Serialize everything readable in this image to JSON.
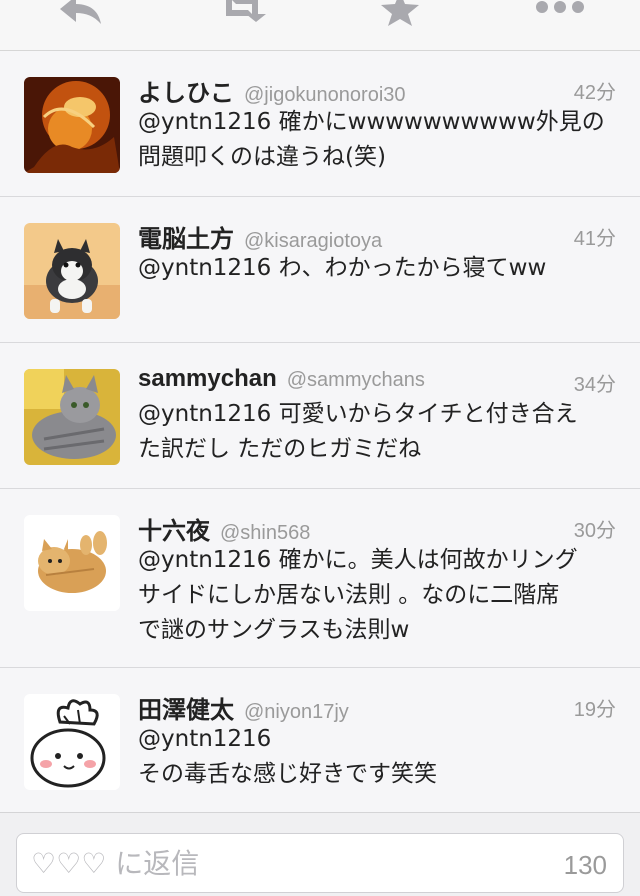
{
  "toolbar": {
    "icons": [
      "reply-icon",
      "retweet-icon",
      "favorite-icon",
      "more-icon"
    ]
  },
  "tweets": [
    {
      "name": "よしひこ",
      "handle": "@jigokunonoroi30",
      "time": "42分",
      "lines": [
        "@yntn1216 確かにwwwwwwwwww外見の",
        "問題叩くのは違うね(笑)"
      ]
    },
    {
      "name": "電脳土方",
      "handle": "@kisaragiotoya",
      "time": "41分",
      "lines": [
        "@yntn1216 わ、わかったから寝てww"
      ]
    },
    {
      "name": "sammychan",
      "handle": "@sammychans",
      "time": "34分",
      "lines": [
        "@yntn1216 可愛いからタイチと付き合え",
        "た訳だし ただのヒガミだね"
      ]
    },
    {
      "name": "十六夜",
      "handle": "@shin568",
      "time": "30分",
      "lines": [
        "@yntn1216 確かに。美人は何故かリング",
        "サイドにしか居ない法則 。なのに二階席",
        "で謎のサングラスも法則w"
      ]
    },
    {
      "name": "田澤健太",
      "handle": "@niyon17jy",
      "time": "19分",
      "lines": [
        "@yntn1216",
        "その毒舌な感じ好きです笑笑"
      ]
    }
  ],
  "reply": {
    "placeholder": "♡♡♡ に返信",
    "char_count": "130"
  },
  "colors": {
    "text": "#222222",
    "muted": "#9a9a9a",
    "icon": "#a9a9ae"
  }
}
